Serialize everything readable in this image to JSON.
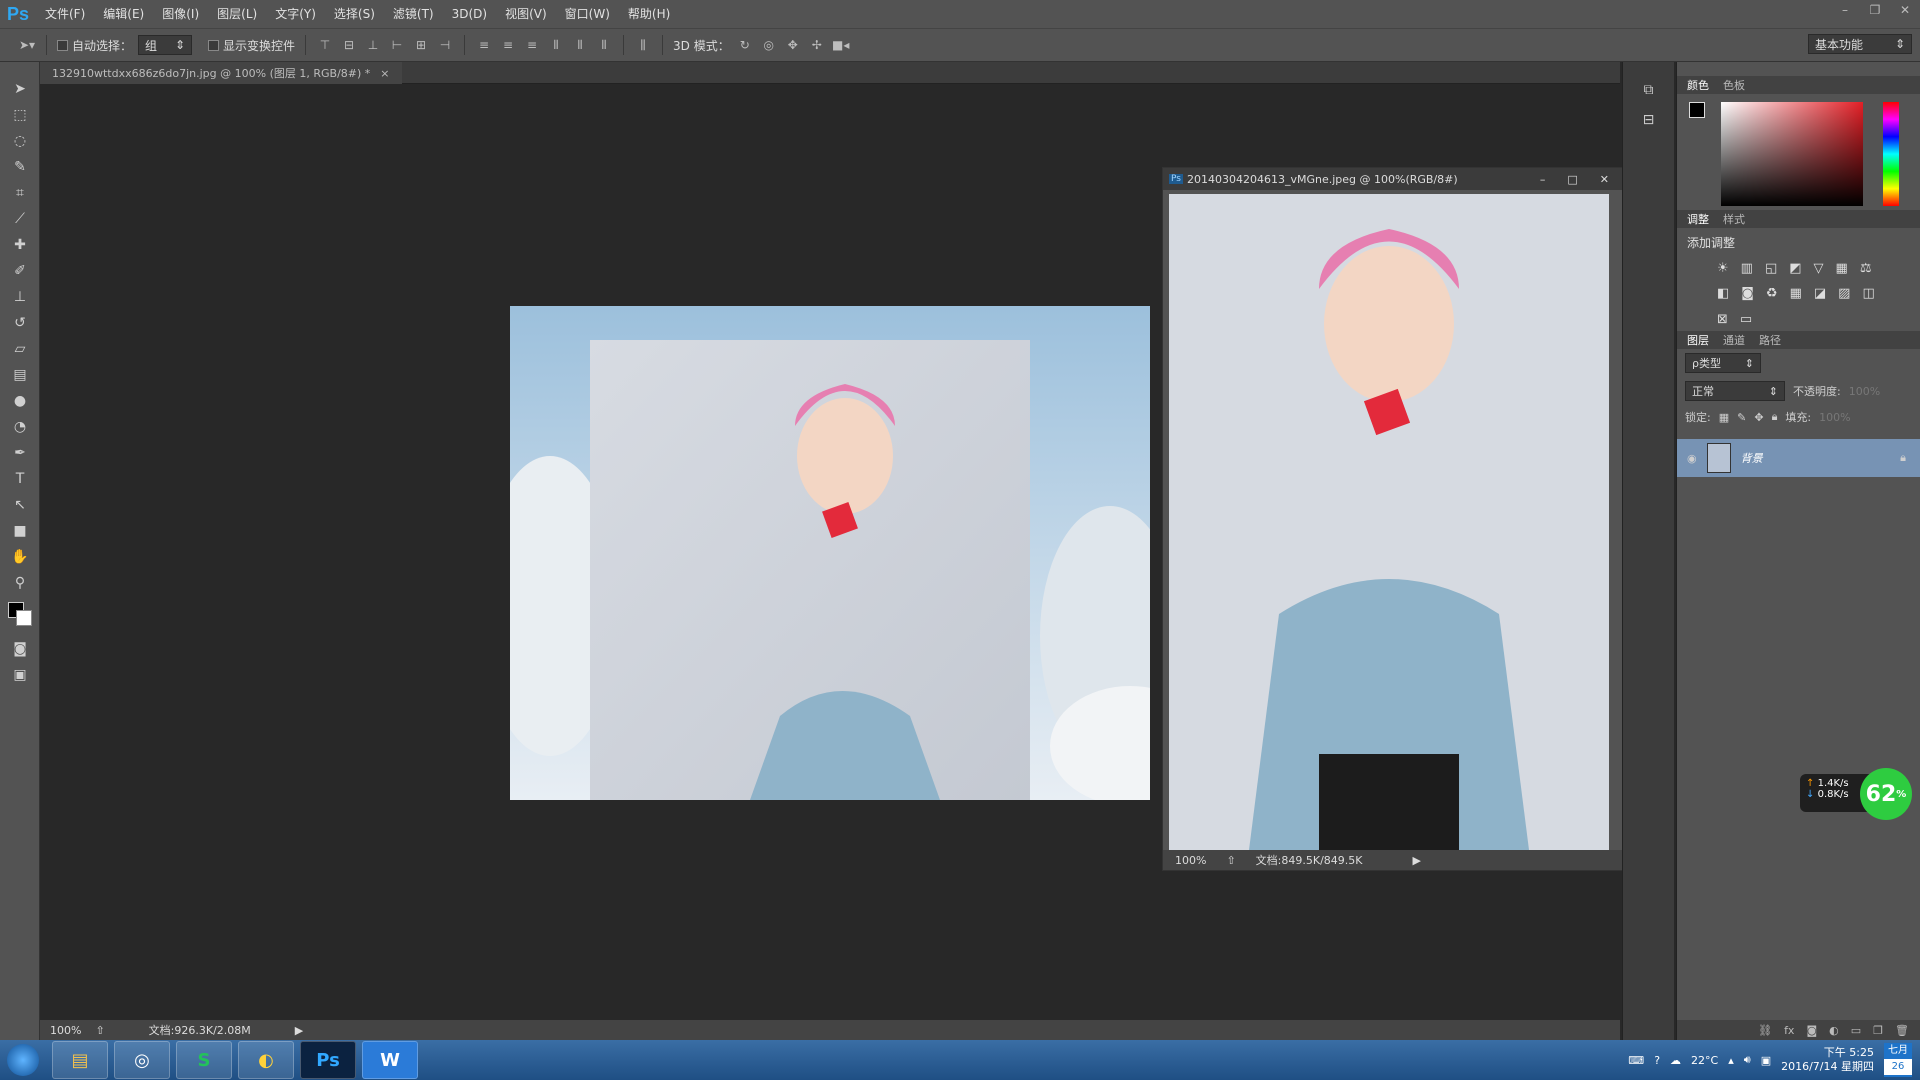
{
  "app": {
    "logo": "Ps"
  },
  "menu": [
    "文件(F)",
    "编辑(E)",
    "图像(I)",
    "图层(L)",
    "文字(Y)",
    "选择(S)",
    "滤镜(T)",
    "3D(D)",
    "视图(V)",
    "窗口(W)",
    "帮助(H)"
  ],
  "options": {
    "auto_select_label": "自动选择：",
    "auto_select_value": "组",
    "show_transform_label": "显示变换控件",
    "mode_3d_label": "3D 模式：",
    "workspace": "基本功能"
  },
  "doc1": {
    "tab_title": "132910wttdxx686z6do7jn.jpg @ 100% (图层 1, RGB/8#) *",
    "zoom": "100%",
    "doc_size": "文档:926.3K/2.08M"
  },
  "doc2": {
    "title": "20140304204613_vMGne.jpeg @ 100%(RGB/8#)",
    "zoom": "100%",
    "doc_size": "文档:849.5K/849.5K"
  },
  "panels": {
    "color_tabs": [
      "颜色",
      "色板"
    ],
    "adjust_tabs": [
      "调整",
      "样式"
    ],
    "add_adjustment": "添加调整",
    "layer_tabs": [
      "图层",
      "通道",
      "路径"
    ],
    "kind_filter": "ρ类型",
    "blend_mode": "正常",
    "opacity_label": "不透明度:",
    "opacity_value": "100%",
    "lock_label": "锁定:",
    "fill_label": "填充:",
    "fill_value": "100%",
    "layer_name": "背景"
  },
  "netmon": {
    "up": "1.4K/s",
    "down": "0.8K/s",
    "percent": "62"
  },
  "tray": {
    "weather": "22°C",
    "time": "下午 5:25",
    "date": "2016/7/14 星期四",
    "lunar_month": "七月",
    "lunar_day": "26"
  },
  "colors": {
    "accent": "#2fa8f3",
    "ui_bg": "#535353",
    "canvas_bg": "#282828",
    "netmon_green": "#2ecc40"
  }
}
